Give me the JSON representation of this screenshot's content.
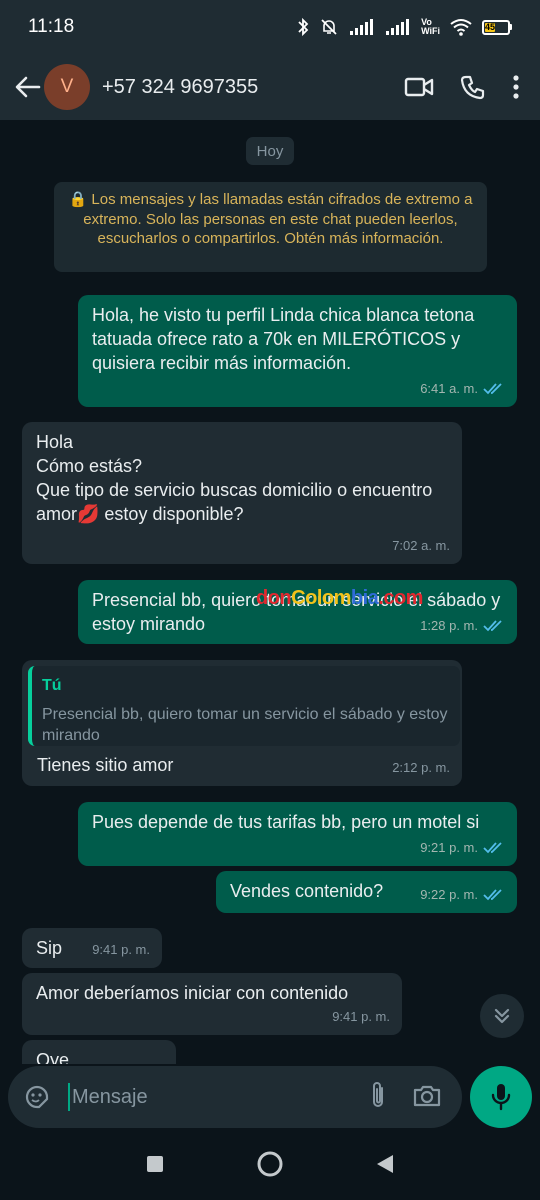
{
  "status_bar": {
    "time": "11:18",
    "vowifi_top": "Vo",
    "vowifi_bottom": "WiFi",
    "battery_level": "45"
  },
  "header": {
    "avatar_initial": "V",
    "contact": "+57 324 9697355",
    "icons": [
      "back-arrow-icon",
      "video-call-icon",
      "voice-call-icon",
      "more-vert-icon"
    ]
  },
  "chat": {
    "date_chip": "Hoy",
    "encryption_notice": "🔒 Los mensajes y las llamadas están cifrados de extremo a extremo. Solo las personas en este chat pueden leerlos, escucharlos o compartirlos. Obtén más información.",
    "watermark": {
      "part1": "don",
      "part2": "Colom",
      "part3": "bia",
      "part4": ".com"
    },
    "messages": [
      {
        "dir": "out",
        "text": "Hola, he visto tu perfil Linda chica blanca tetona tatuada ofrece rato a 70k en MILERÓTICOS y quisiera recibir más información.",
        "time": "6:41 a. m."
      },
      {
        "dir": "in",
        "text": "Hola\nCómo estás?\nQue tipo de servicio buscas domicilio o encuentro amor💋 estoy disponible?",
        "time": "7:02 a. m."
      },
      {
        "dir": "out",
        "text": "Presencial bb, quiero tomar un servicio el sábado y estoy mirando",
        "time": "1:28 p. m."
      },
      {
        "dir": "in",
        "quote_author": "Tú",
        "quote_text": "Presencial bb, quiero tomar un servicio el sábado y estoy mirando",
        "text": "Tienes sitio amor",
        "time": "2:12 p. m."
      },
      {
        "dir": "out",
        "text": "Pues depende de tus tarifas bb, pero un motel si",
        "time": "9:21 p. m."
      },
      {
        "dir": "out",
        "text": "Vendes contenido?",
        "time": "9:22 p. m."
      },
      {
        "dir": "in",
        "text": "Sip",
        "time": "9:41 p. m."
      },
      {
        "dir": "in",
        "text": "Amor deberíamos iniciar con contenido",
        "time": "9:41 p. m."
      },
      {
        "dir": "in",
        "text": "Oye",
        "time": ""
      }
    ]
  },
  "composer": {
    "placeholder": "Mensaje"
  },
  "colors": {
    "outgoing_bubble": "#005c4b",
    "incoming_bubble": "#202c33",
    "accent": "#00a884",
    "read_ticks": "#53bdeb"
  }
}
